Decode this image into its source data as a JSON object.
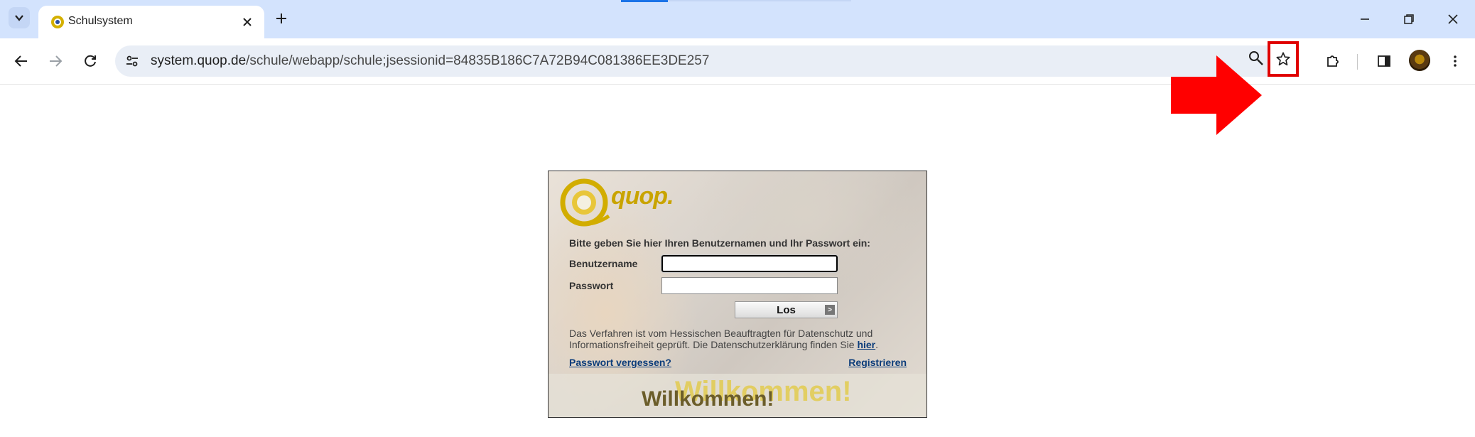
{
  "browser": {
    "tab": {
      "title": "Schulsystem"
    },
    "url": {
      "host": "system.quop.de",
      "path": "/schule/webapp/schule;jsessionid=84835B186C7A72B94C081386EE3DE257"
    }
  },
  "annotation": {
    "arrow_color": "#ff0000",
    "highlight_color": "#e00000"
  },
  "login": {
    "logo_text": "quop.",
    "prompt": "Bitte geben Sie hier Ihren Benutzernamen und Ihr Passwort ein:",
    "username_label": "Benutzername",
    "password_label": "Passwort",
    "username_value": "",
    "password_value": "",
    "submit_label": "Los",
    "submit_arrow": ">",
    "info_text": "Das Verfahren ist vom Hessischen Beauftragten für Datenschutz und Informationsfreiheit geprüft. Die Datenschutzerklärung finden Sie ",
    "info_link": "hier",
    "info_end": ".",
    "forgot_password": "Passwort vergessen?",
    "register": "Registrieren",
    "welcome": "Willkommen!"
  }
}
